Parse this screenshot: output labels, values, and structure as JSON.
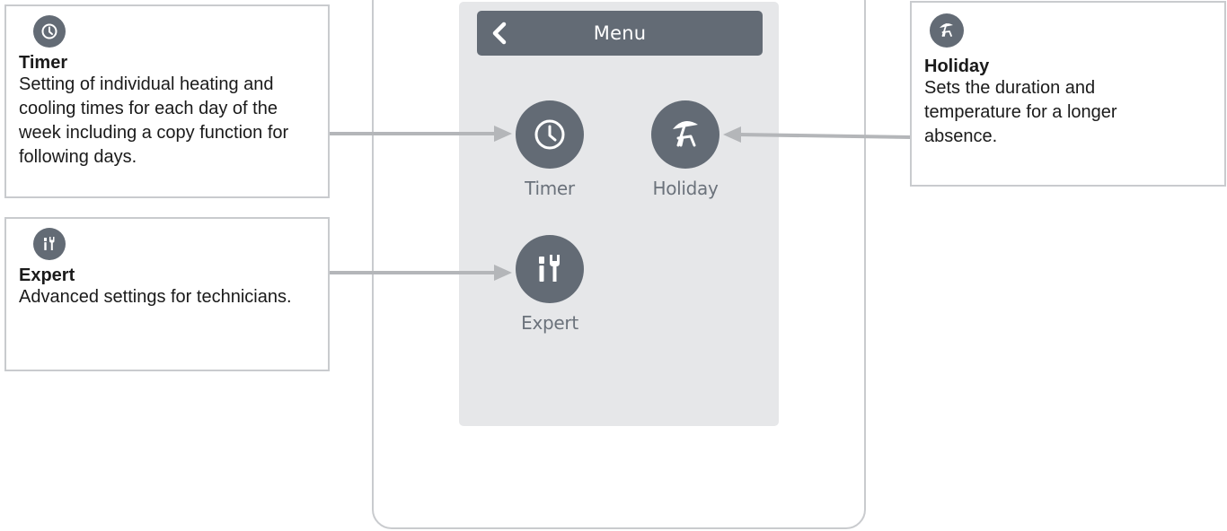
{
  "menu": {
    "title": "Menu",
    "back_icon": "chevron-left-icon"
  },
  "tiles": [
    {
      "label": "Timer",
      "icon": "clock-icon"
    },
    {
      "label": "Holiday",
      "icon": "beach-umbrella-icon"
    },
    {
      "label": "Expert",
      "icon": "tools-icon"
    }
  ],
  "callouts": {
    "timer": {
      "icon": "clock-icon",
      "title": "Timer",
      "text": "Setting of individual heating and cooling times for each day of the week including a copy function for following days."
    },
    "holiday": {
      "icon": "beach-umbrella-icon",
      "title": "Holiday",
      "text": "Sets the duration and temperature for a longer absence."
    },
    "expert": {
      "icon": "tools-icon",
      "title": "Expert",
      "text": "Advanced settings for technicians."
    }
  },
  "colors": {
    "icon_fill": "#636b75",
    "screen_bg": "#e6e7e9",
    "connector": "#b4b6b9",
    "frame_border": "#c9cbce"
  }
}
